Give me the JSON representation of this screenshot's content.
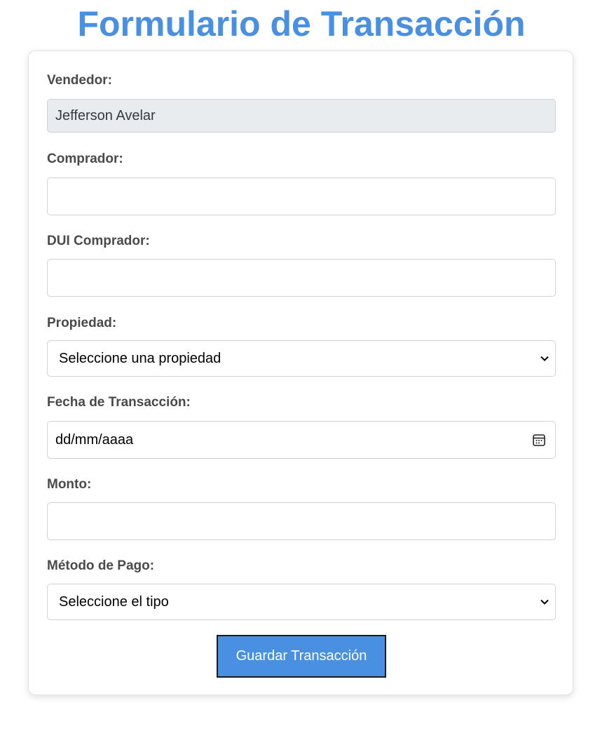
{
  "page": {
    "title": "Formulario de Transacción",
    "accent_color": "#4a90e2"
  },
  "form": {
    "vendedor": {
      "label": "Vendedor:",
      "value": "Jefferson Avelar"
    },
    "comprador": {
      "label": "Comprador:",
      "value": ""
    },
    "dui_comprador": {
      "label": "DUI Comprador:",
      "value": ""
    },
    "propiedad": {
      "label": "Propiedad:",
      "selected": "Seleccione una propiedad"
    },
    "fecha": {
      "label": "Fecha de Transacción:",
      "placeholder": "dd/mm/aaaa",
      "icon": "calendar-icon"
    },
    "monto": {
      "label": "Monto:",
      "value": ""
    },
    "metodo_pago": {
      "label": "Método de Pago:",
      "selected": "Seleccione el tipo"
    },
    "submit_label": "Guardar Transacción"
  }
}
